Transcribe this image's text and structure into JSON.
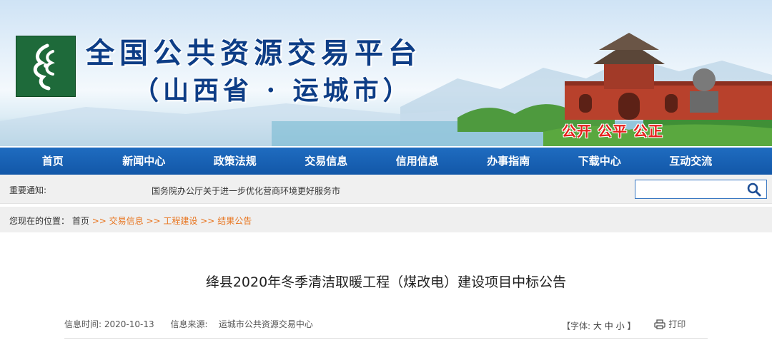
{
  "header": {
    "title": "全国公共资源交易平台",
    "subtitle": "（山西省 · 运城市）",
    "slogan": "公开 公平 公正"
  },
  "nav": {
    "items": [
      "首页",
      "新闻中心",
      "政策法规",
      "交易信息",
      "信用信息",
      "办事指南",
      "下载中心",
      "互动交流"
    ]
  },
  "notice": {
    "label": "重要通知:",
    "text": "国务院办公厅关于进一步优化营商环境更好服务市"
  },
  "search": {
    "value": "",
    "placeholder": "",
    "icon": "search-icon"
  },
  "breadcrumb": {
    "prefix": "您现在的位置：",
    "home": "首页",
    "sep": ">>",
    "items": [
      "交易信息",
      "工程建设",
      "结果公告"
    ]
  },
  "article": {
    "title": "绛县2020年冬季清洁取暖工程（煤改电）建设项目中标公告",
    "date_label": "信息时间:",
    "date": "2020-10-13",
    "source_label": "信息来源:",
    "source": "运城市公共资源交易中心",
    "font_label": "【字体:",
    "font_large": "大",
    "font_medium": "中",
    "font_small": "小",
    "font_close": "】",
    "print_label": "打印"
  },
  "colors": {
    "nav_bg": "#1257a8",
    "title_blue": "#0d3d86",
    "slogan_red": "#e5201c",
    "breadcrumb_orange": "#e8741e",
    "logo_green": "#1e6a3a"
  }
}
